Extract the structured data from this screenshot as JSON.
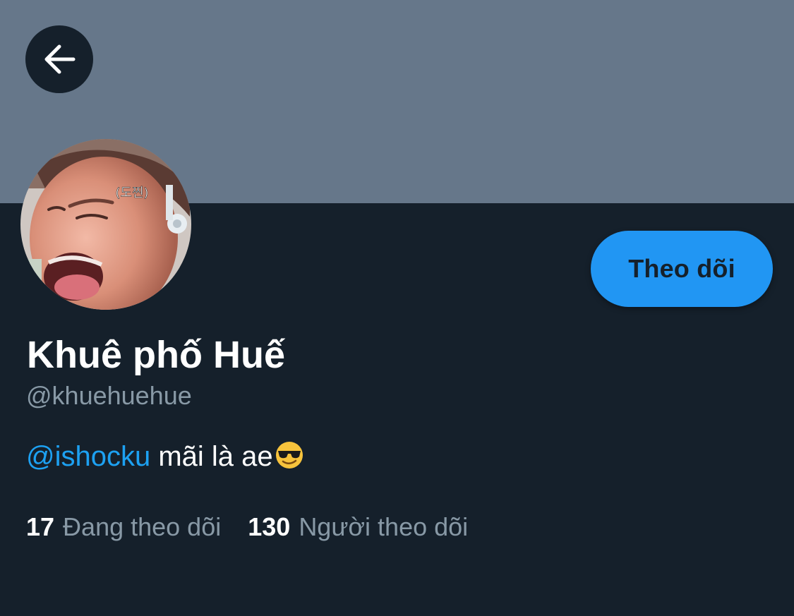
{
  "profile": {
    "banner_color": "#66778a",
    "background_color": "#15202b",
    "display_name": "Khuê phố Huế",
    "handle": "@khuehuehue",
    "bio": {
      "mention": "@ishocku",
      "text": " mãi là ae",
      "emoji": "smiling-face-with-sunglasses"
    },
    "avatar_caption": "(도찐)"
  },
  "header": {
    "back_icon": "arrow-left-icon"
  },
  "follow_button": {
    "label": "Theo dõi",
    "color": "#2196f3"
  },
  "stats": {
    "following_count": "17",
    "following_label": "Đang theo dõi",
    "followers_count": "130",
    "followers_label": "Người theo dõi"
  }
}
